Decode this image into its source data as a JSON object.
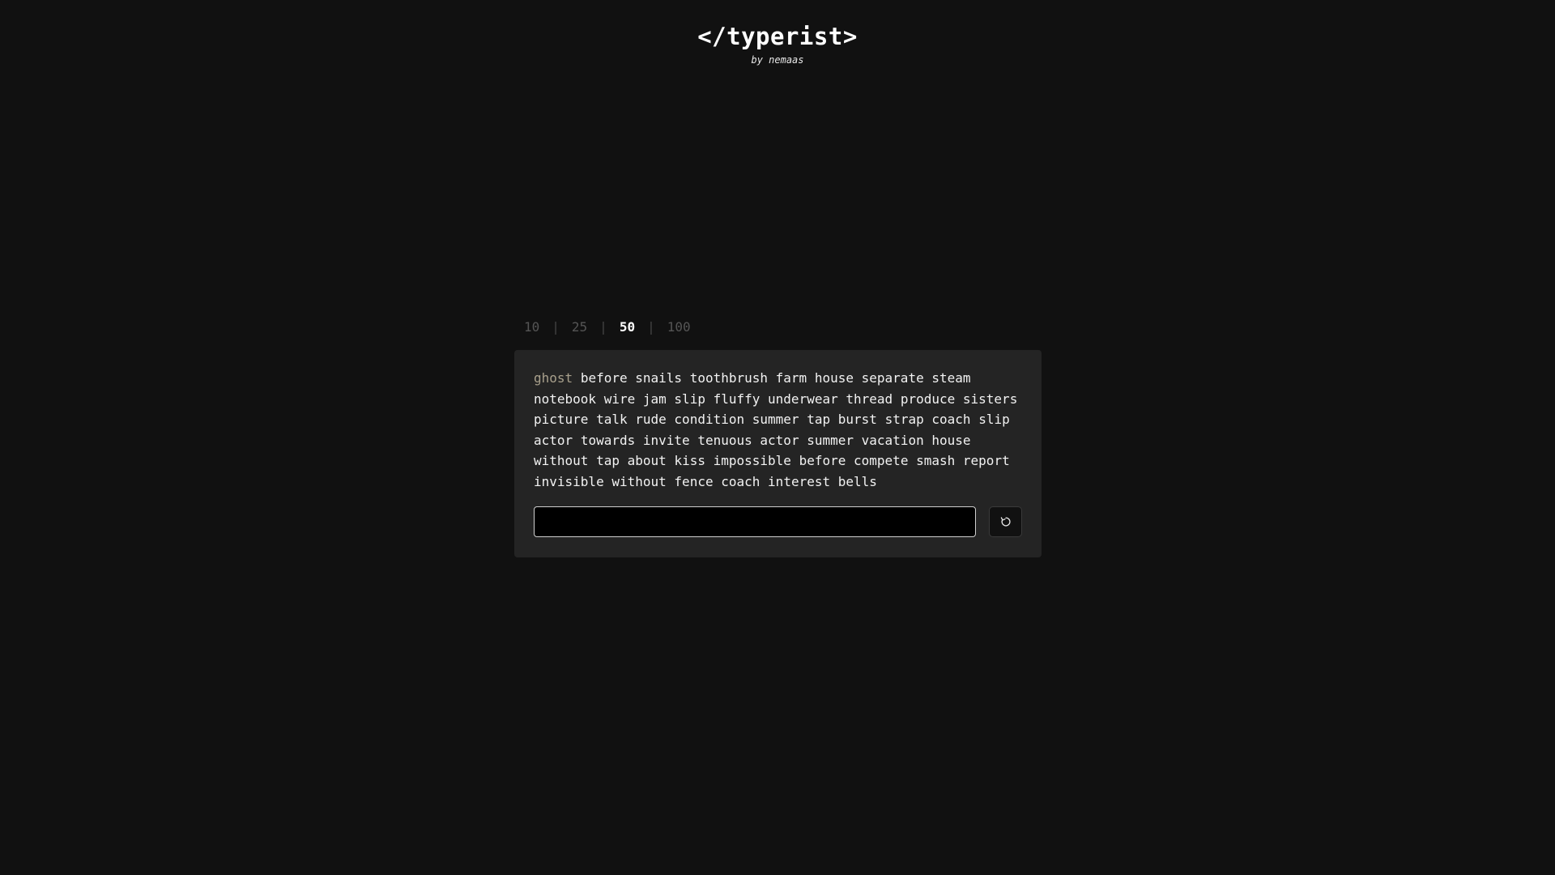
{
  "header": {
    "logo": "</typerist>",
    "byline": "by nemaas"
  },
  "word_counts": {
    "options": [
      "10",
      "25",
      "50",
      "100"
    ],
    "separator": "|",
    "selected": "50"
  },
  "test": {
    "current_word": "ghost",
    "remaining_words": [
      "before",
      "snails",
      "toothbrush",
      "farm",
      "house",
      "separate",
      "steam",
      "notebook",
      "wire",
      "jam",
      "slip",
      "fluffy",
      "underwear",
      "thread",
      "produce",
      "sisters",
      "picture",
      "talk",
      "rude",
      "condition",
      "summer",
      "tap",
      "burst",
      "strap",
      "coach",
      "slip",
      "actor",
      "towards",
      "invite",
      "tenuous",
      "actor",
      "summer",
      "vacation",
      "house",
      "without",
      "tap",
      "about",
      "kiss",
      "impossible",
      "before",
      "compete",
      "smash",
      "report",
      "invisible",
      "without",
      "fence",
      "coach",
      "interest",
      "bells"
    ]
  },
  "input": {
    "value": "",
    "placeholder": ""
  },
  "reset_button": {
    "icon": "refresh-icon"
  },
  "colors": {
    "background": "#111111",
    "card": "#242424",
    "current_word": "#a8a08c",
    "text": "#f2f2f2",
    "inactive_option": "#555555",
    "active_option": "#ffffff"
  }
}
